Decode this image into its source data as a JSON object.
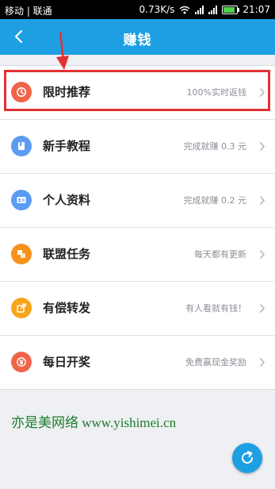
{
  "status_bar": {
    "carrier": "移动 | 联通",
    "speed": "0.73K/s",
    "time": "21:07"
  },
  "nav": {
    "title": "赚钱"
  },
  "items": [
    {
      "label": "限时推荐",
      "desc": "100%实时返钱",
      "icon": "clock-icon",
      "color": "#f06449"
    },
    {
      "label": "新手教程",
      "desc": "完成就赚 0.3 元",
      "icon": "book-icon",
      "color": "#5b9cf2"
    },
    {
      "label": "个人资料",
      "desc": "完成就赚 0.2 元",
      "icon": "id-card-icon",
      "color": "#5b9cf2"
    },
    {
      "label": "联盟任务",
      "desc": "每天都有更新",
      "icon": "puzzle-icon",
      "color": "#f7911c"
    },
    {
      "label": "有偿转发",
      "desc": "有人看就有钱！",
      "icon": "share-icon",
      "color": "#f7a51c"
    },
    {
      "label": "每日开奖",
      "desc": "免费赢现金奖励",
      "icon": "yen-coin-icon",
      "color": "#f06449"
    }
  ],
  "watermark": "亦是美网络 www.yishimei.cn",
  "colors": {
    "accent": "#1e9fe4",
    "highlight_border": "#e23232",
    "watermark": "#1b7c2a"
  }
}
